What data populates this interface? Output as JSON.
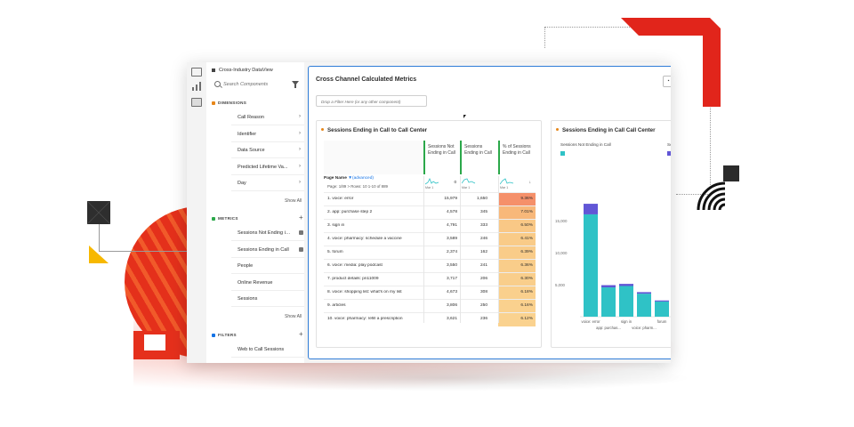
{
  "left_panel": {
    "dataview": "Cross-Industry DataView",
    "search_placeholder": "Search Components",
    "dimensions": {
      "header": "DIMENSIONS",
      "items": [
        "Call Reason",
        "Identifier",
        "Data Source",
        "Predicted Lifetime Va...",
        "Day"
      ],
      "show_all": "Show All"
    },
    "metrics": {
      "header": "METRICS",
      "items": [
        "Sessions Not Ending in...",
        "Sessions Ending in Call",
        "People",
        "Online Revenue",
        "Sessions"
      ],
      "show_all": "Show All"
    },
    "filters": {
      "header": "FILTERS",
      "items": [
        "Web to Call Sessions"
      ]
    }
  },
  "workspace": {
    "title": "Cross Channel Calculated Metrics",
    "drop_zone": "Drop a Filter Here (or any other component)"
  },
  "table": {
    "title": "Sessions Ending in Call to Call Center",
    "columns": [
      "Sessions Not Ending in Call",
      "Sessions Ending in Call",
      "% of Sessions Ending in Call"
    ],
    "dimension_label": "Page Name",
    "dimension_filter": "(advanced)",
    "pagination": "Page: 1/89 >  Rows: 10  1-10 of 889",
    "totals": [
      "0",
      "",
      ""
    ],
    "spark_labels": [
      "Mar 1",
      "Mar 1",
      "Mar 1"
    ],
    "rows": [
      {
        "name": "1. voice: error",
        "a": "15,979",
        "b": "1,650",
        "pct": "9.36%"
      },
      {
        "name": "2. app: purchase step 2",
        "a": "4,578",
        "b": "345",
        "pct": "7.01%"
      },
      {
        "name": "3. sign in",
        "a": "4,791",
        "b": "333",
        "pct": "6.50%"
      },
      {
        "name": "4. voice: pharmacy: schedule a vaccine",
        "a": "3,589",
        "b": "246",
        "pct": "6.41%"
      },
      {
        "name": "5. forum",
        "a": "2,374",
        "b": "162",
        "pct": "6.39%"
      },
      {
        "name": "6. voice: media: play podcast",
        "a": "3,550",
        "b": "241",
        "pct": "6.36%"
      },
      {
        "name": "7. product details: pn11009",
        "a": "3,717",
        "b": "206",
        "pct": "6.30%"
      },
      {
        "name": "8. voice: shopping list: what's on my list",
        "a": "4,673",
        "b": "308",
        "pct": "6.18%"
      },
      {
        "name": "9. articles",
        "a": "3,806",
        "b": "250",
        "pct": "6.16%"
      },
      {
        "name": "10. voice: pharmacy: refill a prescription",
        "a": "3,621",
        "b": "236",
        "pct": "6.12%"
      }
    ],
    "heat_colors": [
      "#f5906a",
      "#f8b87a",
      "#f9c886",
      "#f9cb88",
      "#f9cc89",
      "#f9cd8a",
      "#f9ce8b",
      "#fad08d",
      "#fad18e",
      "#fad28f"
    ]
  },
  "chart_data": {
    "type": "bar",
    "title": "Sessions Ending in Call Call Center",
    "series": [
      {
        "name": "Sessions Not Ending in Call",
        "color": "#2fc2c6",
        "values": [
          15979,
          4578,
          4791,
          3589,
          2374
        ]
      },
      {
        "name": "Se",
        "color": "#6156d6",
        "values": [
          1650,
          345,
          333,
          246,
          162
        ]
      }
    ],
    "categories": [
      "voice: error",
      "app: purchas...",
      "sign in",
      "voice: pharm...",
      "forum"
    ],
    "category_labels_row1": [
      "voice: error",
      "sign in",
      "forum"
    ],
    "category_labels_row2": [
      "app: purchas...",
      "voice: pharm...",
      "voi"
    ],
    "y_ticks": [
      "15,000",
      "10,000",
      "5,000"
    ],
    "ylim": [
      0,
      20000
    ],
    "stacked": true
  }
}
